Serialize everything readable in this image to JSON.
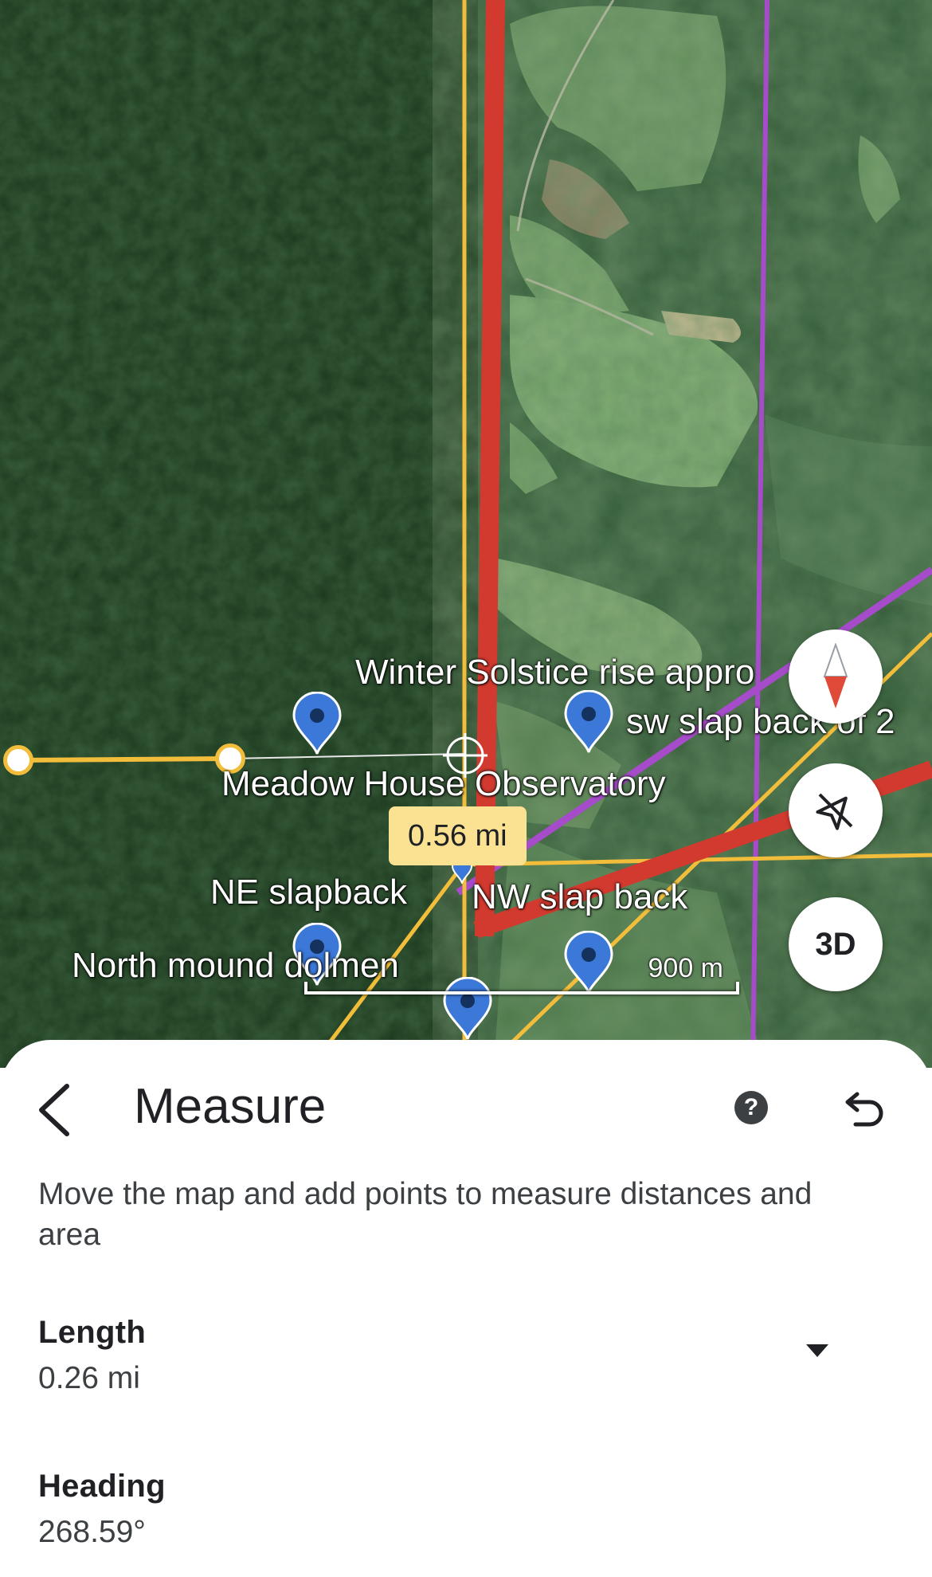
{
  "map": {
    "labels": {
      "winter_solstice": "Winter Solstice rise appro",
      "sw_slap_back": "sw slap back of 2",
      "meadow_house": "Meadow House Observatory",
      "ne_slapback": "NE slapback",
      "nw_slap_back": "NW slap back",
      "north_mound": "North mound dolmen"
    },
    "measure_tip": "0.56 mi",
    "scale_label": "900 m",
    "button_3d": "3D",
    "colors": {
      "red_line": "#d23a2f",
      "yellow_line": "#f1bd3b",
      "purple_line": "#a64bc9",
      "pin": "#3b78d8",
      "forest_dark": "#1d3a1e",
      "field_green": "#6f9a63"
    },
    "icons": [
      "compass-icon",
      "navigation-off-icon",
      "crosshair-icon",
      "map-pin-icon"
    ]
  },
  "sheet": {
    "title": "Measure",
    "description": "Move the map and add points to measure distances and area",
    "length_label": "Length",
    "length_value": "0.26 mi",
    "heading_label": "Heading",
    "heading_value": "268.59°",
    "icons": [
      "back-arrow-icon",
      "help-icon",
      "undo-icon",
      "dropdown-icon"
    ]
  }
}
